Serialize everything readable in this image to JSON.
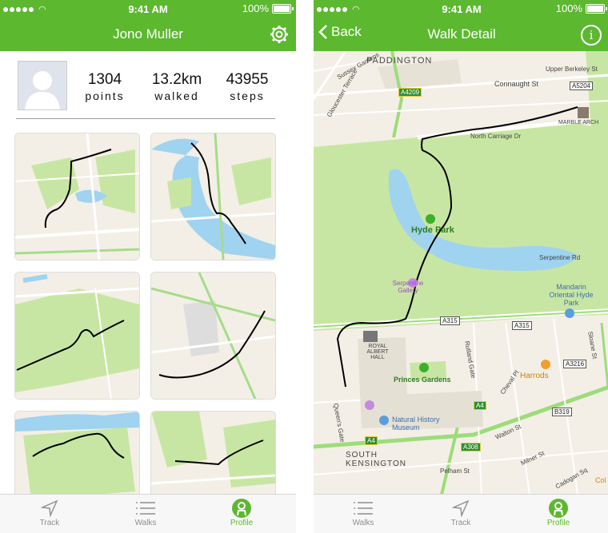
{
  "status": {
    "time": "9:41 AM",
    "battery": "100%"
  },
  "profile": {
    "title": "Jono Muller",
    "stats": [
      {
        "value": "1304",
        "label": "points"
      },
      {
        "value": "13.2km",
        "label": "walked"
      },
      {
        "value": "43955",
        "label": "steps"
      }
    ]
  },
  "profile_tabs": [
    {
      "label": "Track",
      "icon": "navigation-arrow-icon",
      "active": false
    },
    {
      "label": "Walks",
      "icon": "list-icon",
      "active": false
    },
    {
      "label": "Profile",
      "icon": "person-icon",
      "active": true
    }
  ],
  "detail": {
    "back_label": "Back",
    "title": "Walk Detail",
    "info_icon": "i",
    "map_labels": {
      "paddington": "PADDINGTON",
      "connaught": "Connaught St",
      "upper_berkeley": "Upper Berkeley St",
      "marble_arch": "MARBLE ARCH",
      "north_carriage": "North Carriage Dr",
      "hyde_park": "Hyde Park",
      "serpentine_gallery": "Serpentine Gallery",
      "serpentine_rd": "Serpentine Rd",
      "mandarin": "Mandarin Oriental Hyde Park",
      "royal_albert": "ROYAL ALBERT HALL",
      "princes_gardens": "Princes Gardens",
      "harrods": "Harrods",
      "nhm": "Natural History Museum",
      "south_kensington": "SOUTH KENSINGTON",
      "queens_gate": "Queen's Gate",
      "pelham": "Pelham St",
      "walton": "Walton St",
      "milner": "Milner St",
      "cheval": "Cheval Pl",
      "rutland": "Rutland Gate",
      "gloucester": "Gloucester Terrace",
      "sussex": "Sussex Gardens",
      "cadogan": "Cadogan Sq",
      "sloane": "Sloane St",
      "col": "Col"
    },
    "road_signs": {
      "a4209": "A4209",
      "a5204": "A5204",
      "a315a": "A315",
      "a315b": "A315",
      "a3216": "A3216",
      "a4a": "A4",
      "a4b": "A4",
      "b319": "B319",
      "a308": "A308"
    }
  },
  "detail_tabs": [
    {
      "label": "Walks",
      "icon": "list-icon",
      "active": false
    },
    {
      "label": "Track",
      "icon": "navigation-arrow-icon",
      "active": false
    },
    {
      "label": "Profile",
      "icon": "person-icon",
      "active": true
    }
  ],
  "colors": {
    "accent": "#5cb82f",
    "park": "#c8e6a3",
    "water": "#9fd3f0",
    "road": "#ffffff",
    "land": "#f3efe6"
  }
}
